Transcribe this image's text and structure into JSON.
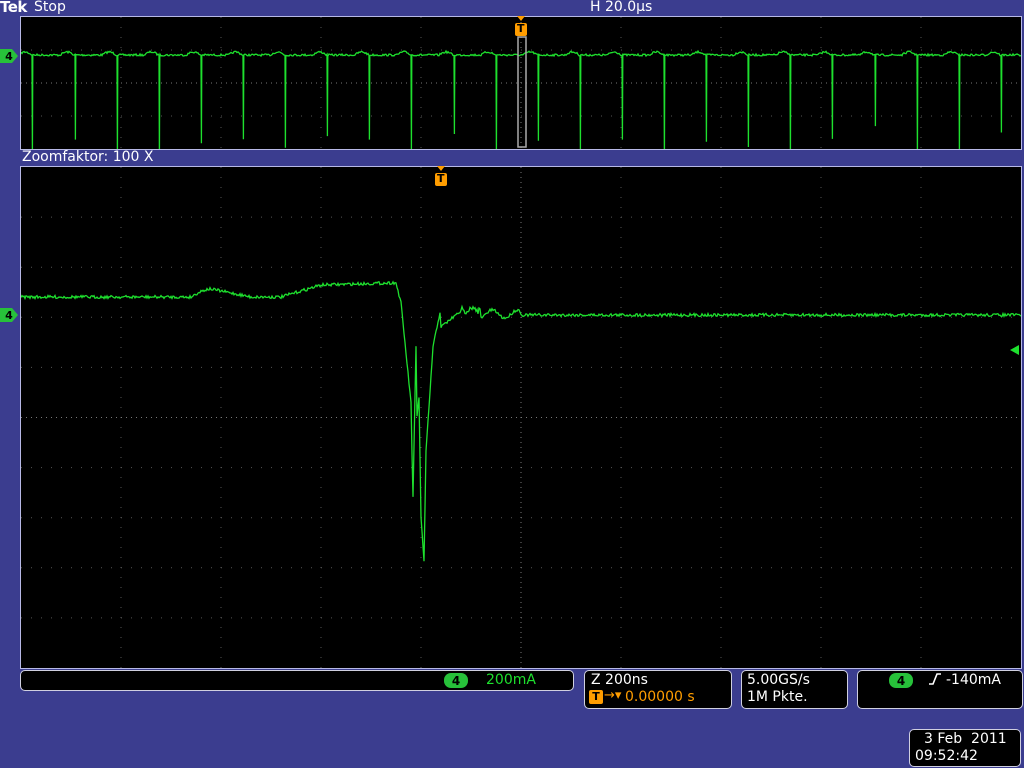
{
  "header": {
    "brand": "Tek",
    "run_state": "Stop",
    "horizontal_scale": "H 20.0μs"
  },
  "overview": {
    "channel_marker": "4",
    "trigger_marker": "T"
  },
  "zoom": {
    "label": "Zoomfaktor: 100 X",
    "channel_marker": "4",
    "trigger_marker": "T"
  },
  "readouts": {
    "channel_badge": "4",
    "vertical_scale": "200mA",
    "zoom_timebase": "Z 200ns",
    "trigger_position_icon": "T",
    "trigger_position_value": "0.00000 s",
    "sample_rate": "5.00GS/s",
    "record_length": "1M Pkte.",
    "trigger_channel_badge": "4",
    "trigger_level": "-140mA"
  },
  "datetime": {
    "date": "3 Feb  2011",
    "time": "09:52:42"
  },
  "colors": {
    "background": "#3b3d8f",
    "trace": "#1ee02e",
    "trigger": "#ff9d00",
    "grid": "#8a8a8a"
  }
}
